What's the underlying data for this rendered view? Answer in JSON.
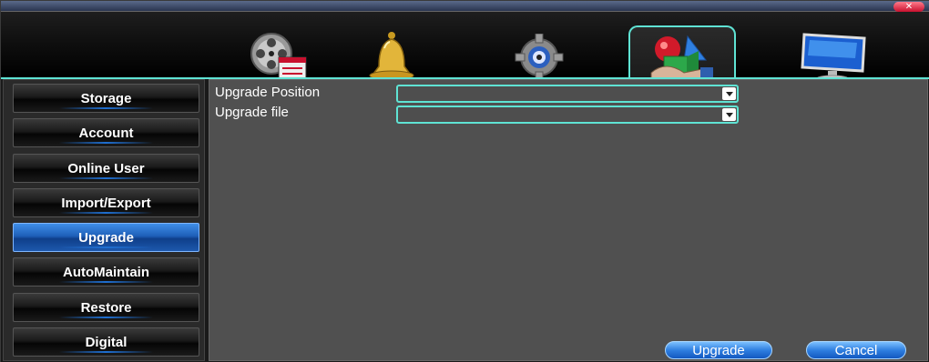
{
  "window": {
    "close_glyph": "✕"
  },
  "toolbar": {
    "tabs": [
      {
        "icon": "film-reel-icon",
        "active": false
      },
      {
        "icon": "bell-icon",
        "active": false
      },
      {
        "icon": "gear-icon",
        "active": false
      },
      {
        "icon": "system-tools-icon",
        "active": true
      },
      {
        "icon": "monitor-icon",
        "active": false
      }
    ]
  },
  "sidebar": {
    "items": [
      {
        "label": "Storage"
      },
      {
        "label": "Account"
      },
      {
        "label": "Online User"
      },
      {
        "label": "Import/Export"
      },
      {
        "label": "Upgrade"
      },
      {
        "label": "AutoMaintain"
      },
      {
        "label": "Restore"
      },
      {
        "label": "Digital"
      }
    ],
    "active_index": 4
  },
  "form": {
    "upgrade_position_label": "Upgrade Position",
    "upgrade_position_value": "",
    "upgrade_file_label": "Upgrade file",
    "upgrade_file_value": ""
  },
  "actions": {
    "upgrade_label": "Upgrade",
    "cancel_label": "Cancel"
  },
  "colors": {
    "accent": "#5fe3d4",
    "active_button": "#1e5fb8",
    "panel_bg": "#505050"
  }
}
